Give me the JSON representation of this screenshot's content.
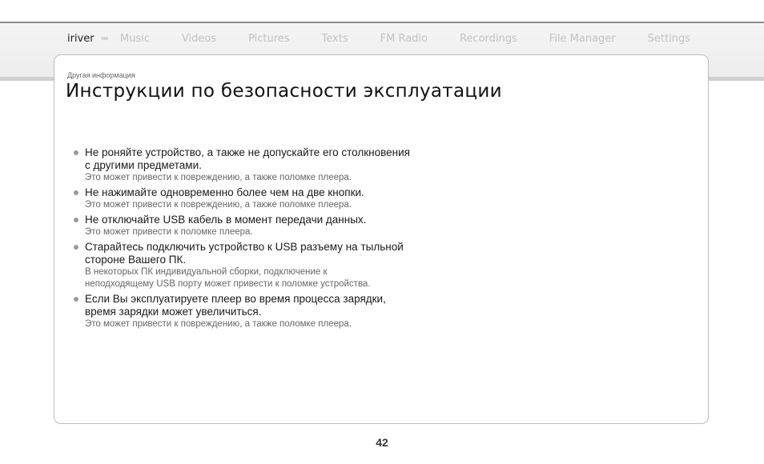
{
  "nav": {
    "brand": "iriver",
    "arrows": "»»",
    "items": [
      "Music",
      "Videos",
      "Pictures",
      "Texts",
      "FM Radio",
      "Recordings",
      "File Manager",
      "Settings"
    ]
  },
  "section_label": "Другая информация",
  "page_title": "Инструкции по безопасности эксплуатации",
  "items": [
    {
      "main": "Не роняйте устройство, а также не допускайте его столкновения с другими предметами.",
      "sub": "Это может привести к повреждению, а также поломке плеера."
    },
    {
      "main": "Не нажимайте одновременно более чем на две кнопки.",
      "sub": "Это может привести к повреждению, а также поломке плеера."
    },
    {
      "main": "Не отключайте USB кабель в момент передачи данных.",
      "sub": "Это может привести к поломке плеера."
    },
    {
      "main": "Старайтесь подключить устройство к USB разъему на тыльной стороне Вашего ПК.",
      "sub": "В некоторых ПК индивидуальной сборки, подключение к неподходящему USB порту может привести к поломке устройства."
    },
    {
      "main": "Если Вы эксплуатируете плеер во время процесса зарядки, время зарядки может увеличиться.",
      "sub": "Это может привести к повреждению, а также поломке плеера."
    }
  ],
  "page_number": "42"
}
